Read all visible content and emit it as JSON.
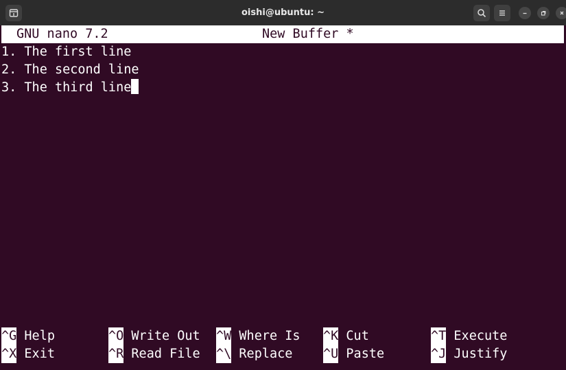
{
  "window": {
    "title": "oishi@ubuntu: ~"
  },
  "nano": {
    "version_label": "GNU nano 7.2",
    "buffer_name": "New Buffer *"
  },
  "lines": [
    "1. The first line",
    "2. The second line",
    "3. The third line"
  ],
  "shortcuts": {
    "row1": [
      {
        "key": "^G",
        "label": "Help"
      },
      {
        "key": "^O",
        "label": "Write Out"
      },
      {
        "key": "^W",
        "label": "Where Is"
      },
      {
        "key": "^K",
        "label": "Cut"
      },
      {
        "key": "^T",
        "label": "Execute"
      }
    ],
    "row2": [
      {
        "key": "^X",
        "label": "Exit"
      },
      {
        "key": "^R",
        "label": "Read File"
      },
      {
        "key": "^\\",
        "label": "Replace"
      },
      {
        "key": "^U",
        "label": "Paste"
      },
      {
        "key": "^J",
        "label": "Justify"
      }
    ]
  },
  "icons": {
    "new_tab": "new-tab-icon",
    "search": "search-icon",
    "menu": "hamburger-menu-icon",
    "minimize": "minimize-icon",
    "maximize": "maximize-icon",
    "close": "close-icon"
  },
  "colors": {
    "terminal_bg": "#300a24",
    "titlebar_bg": "#2c2c2c",
    "text": "#ffffff"
  }
}
